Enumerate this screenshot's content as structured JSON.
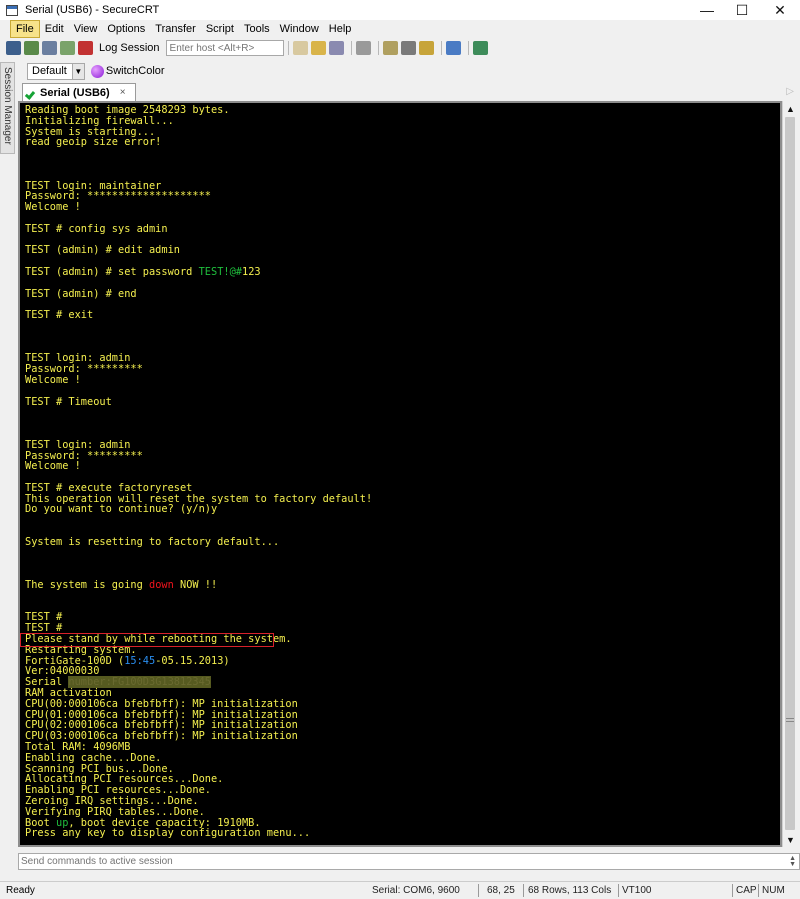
{
  "window": {
    "title": "Serial (USB6) - SecureCRT",
    "minimize": "—",
    "maximize": "☐",
    "close": "✕"
  },
  "menu": [
    "File",
    "Edit",
    "View",
    "Options",
    "Transfer",
    "Script",
    "Tools",
    "Window",
    "Help"
  ],
  "toolbar": {
    "log_label": "Log Session",
    "host_placeholder": "Enter host <Alt+R>"
  },
  "side_panel": {
    "label": "Session Manager"
  },
  "button_bar": {
    "default_label": "Default",
    "switch_color_label": "SwitchColor"
  },
  "tab": {
    "label": "Serial (USB6)",
    "close": "×"
  },
  "terminal_lines": [
    [
      {
        "t": "Reading boot image 2548293 bytes."
      }
    ],
    [
      {
        "t": "Initializing firewall..."
      }
    ],
    [
      {
        "t": "System is starting..."
      }
    ],
    [
      {
        "t": "read geoip size error!"
      }
    ],
    [],
    [],
    [],
    [
      {
        "t": "TEST login: maintainer"
      }
    ],
    [
      {
        "t": "Password: ********************"
      }
    ],
    [
      {
        "t": "Welcome !"
      }
    ],
    [],
    [
      {
        "t": "TEST # config sys admin"
      }
    ],
    [],
    [
      {
        "t": "TEST (admin) # edit admin"
      }
    ],
    [],
    [
      {
        "t": "TEST (admin) # set password "
      },
      {
        "t": "TEST!@#",
        "c": "green"
      },
      {
        "t": "123"
      }
    ],
    [],
    [
      {
        "t": "TEST (admin) # end"
      }
    ],
    [],
    [
      {
        "t": "TEST # exit"
      }
    ],
    [],
    [],
    [],
    [
      {
        "t": "TEST login: admin"
      }
    ],
    [
      {
        "t": "Password: *********"
      }
    ],
    [
      {
        "t": "Welcome !"
      }
    ],
    [],
    [
      {
        "t": "TEST # Timeout"
      }
    ],
    [],
    [],
    [],
    [
      {
        "t": "TEST login: admin"
      }
    ],
    [
      {
        "t": "Password: *********"
      }
    ],
    [
      {
        "t": "Welcome !"
      }
    ],
    [],
    [
      {
        "t": "TEST # execute factoryreset"
      }
    ],
    [
      {
        "t": "This operation will reset the system to factory default!"
      }
    ],
    [
      {
        "t": "Do you want to continue? (y/n)y"
      }
    ],
    [],
    [],
    [
      {
        "t": "System is resetting to factory default..."
      }
    ],
    [],
    [],
    [],
    [
      {
        "t": "The system is going "
      },
      {
        "t": "down",
        "c": "red"
      },
      {
        "t": " NOW !!"
      }
    ],
    [],
    [],
    [
      {
        "t": "TEST #"
      }
    ],
    [
      {
        "t": "TEST #"
      }
    ],
    [
      {
        "t": "Please stand by while rebooting the system."
      }
    ],
    [
      {
        "t": "Restarting system."
      }
    ],
    [
      {
        "t": "FortiGate-100D ("
      },
      {
        "t": "15:45",
        "c": "blue"
      },
      {
        "t": "-05.15.2013)"
      }
    ],
    [
      {
        "t": "Ver:04000030"
      }
    ],
    [
      {
        "t": "Serial "
      },
      {
        "t": "number:FG100D3G13812345",
        "c": "redact"
      }
    ],
    [
      {
        "t": "RAM activation"
      }
    ],
    [
      {
        "t": "CPU(00:000106ca bfebfbff): MP initialization"
      }
    ],
    [
      {
        "t": "CPU(01:000106ca bfebfbff): MP initialization"
      }
    ],
    [
      {
        "t": "CPU(02:000106ca bfebfbff): MP initialization"
      }
    ],
    [
      {
        "t": "CPU(03:000106ca bfebfbff): MP initialization"
      }
    ],
    [
      {
        "t": "Total RAM: 4096MB"
      }
    ],
    [
      {
        "t": "Enabling cache...Done."
      }
    ],
    [
      {
        "t": "Scanning PCI bus...Done."
      }
    ],
    [
      {
        "t": "Allocating PCI resources...Done."
      }
    ],
    [
      {
        "t": "Enabling PCI resources...Done."
      }
    ],
    [
      {
        "t": "Zeroing IRQ settings...Done."
      }
    ],
    [
      {
        "t": "Verifying PIRQ tables...Done."
      }
    ],
    [
      {
        "t": "Boot "
      },
      {
        "t": "up",
        "c": "green"
      },
      {
        "t": ", boot device capacity: 1910MB."
      }
    ],
    [
      {
        "t": "Press any key to display configuration menu..."
      }
    ],
    [
      {
        "t": "......"
      }
    ],
    [],
    [
      {
        "t": "Reading boot image 2548293 bytes."
      }
    ],
    [
      {
        "t": "Initializing firewall..."
      },
      {
        "cursor": true
      }
    ]
  ],
  "command_bar": {
    "placeholder": "Send commands to active session"
  },
  "status_bar": {
    "ready": "Ready",
    "connection": "Serial: COM6, 9600",
    "cursor_pos": "68,  25",
    "size": "68 Rows, 113 Cols",
    "emulation": "VT100",
    "caps": "CAP",
    "num": "NUM"
  }
}
